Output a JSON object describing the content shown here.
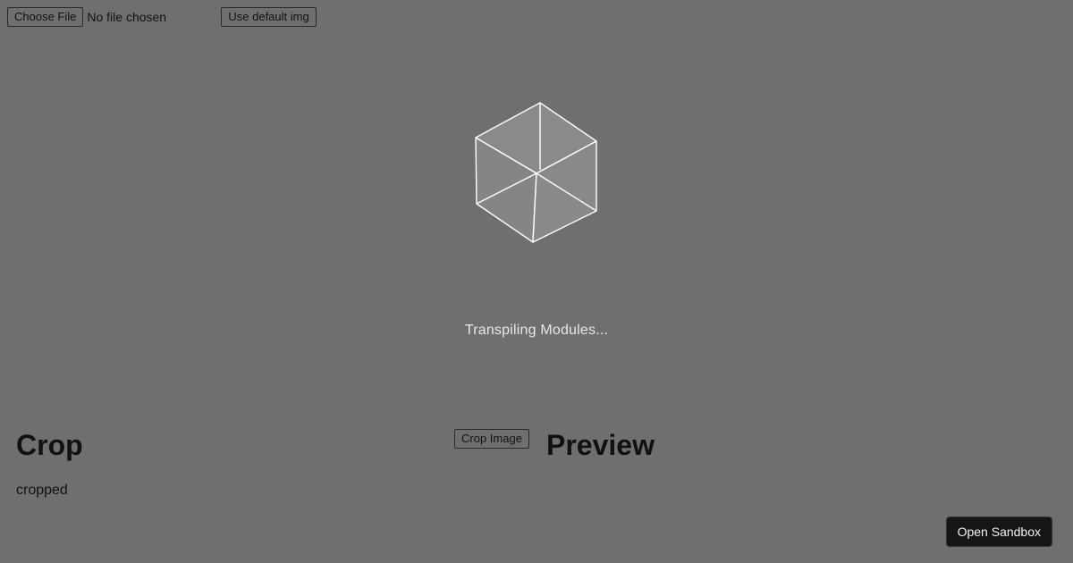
{
  "file_input": {
    "choose_label": "Choose File",
    "status": "No file chosen"
  },
  "toolbar": {
    "default_img_label": "Use default img"
  },
  "loader": {
    "text": "Transpiling Modules..."
  },
  "crop": {
    "title": "Crop",
    "button_label": "Crop Image",
    "image_alt": "cropped"
  },
  "preview": {
    "title": "Preview"
  },
  "sandbox": {
    "button_label": "Open Sandbox"
  },
  "colors": {
    "background": "#6f6f6f",
    "loader_stroke": "#ffffff",
    "sandbox_button_bg": "#151515"
  }
}
